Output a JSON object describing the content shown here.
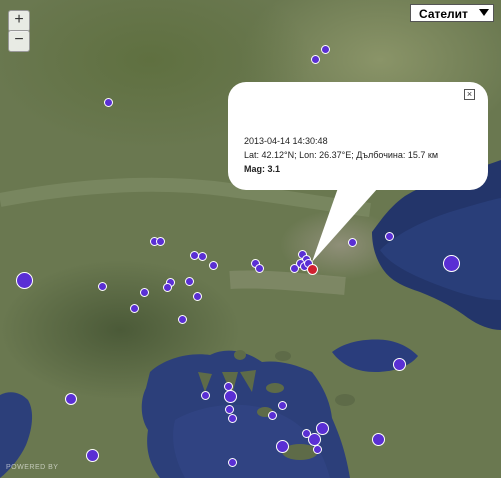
{
  "map": {
    "zoom_in_label": "+",
    "zoom_out_label": "−",
    "map_type_selected": "Сателит",
    "watermark": "POWERED BY"
  },
  "popup": {
    "datetime": "2013-04-14 14:30:48",
    "location_line": "Lat: 42.12°N; Lon: 26.37°E; Дълбочина: 15.7 км",
    "magnitude": "Mag: 3.1",
    "close_glyph": "×"
  },
  "colors": {
    "marker": "#5a2fd4",
    "selected_marker": "#d02030",
    "sea": "#2c3f7a"
  }
}
